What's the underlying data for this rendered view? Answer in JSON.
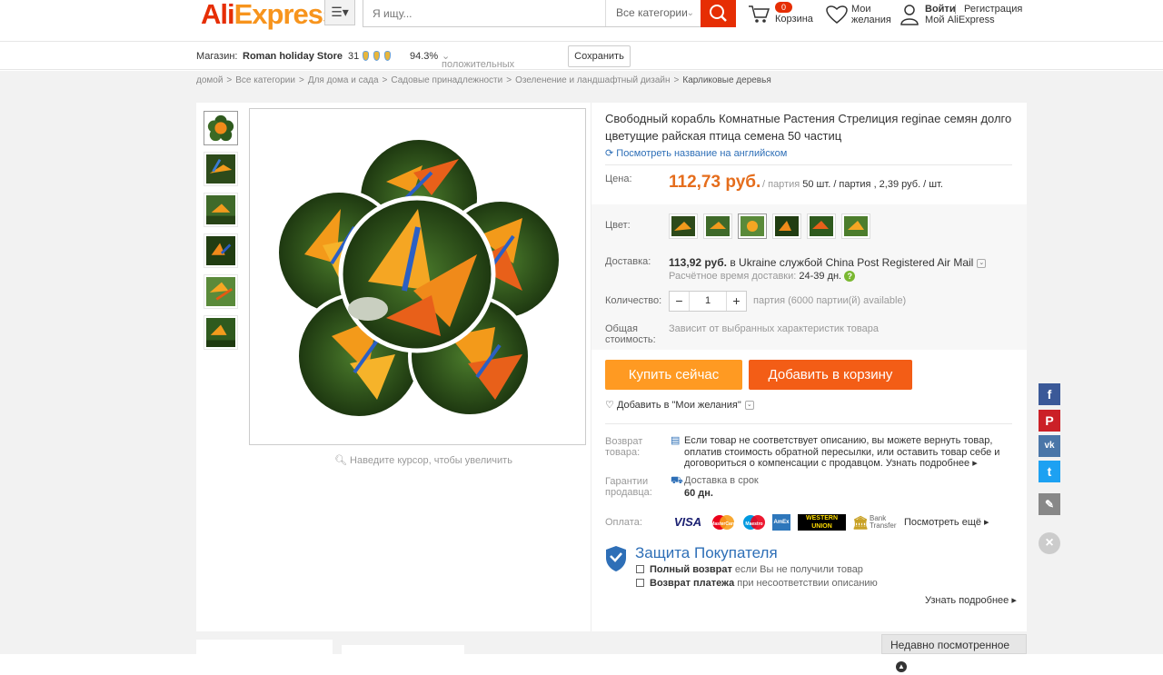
{
  "header": {
    "logo_part1": "Ali",
    "logo_part2": "Express",
    "menu_icon": "hamburger-icon",
    "search_placeholder": "Я ищу...",
    "category_select": "Все категории",
    "cart_label": "Корзина",
    "cart_count": "0",
    "wishlist_line1": "Мои",
    "wishlist_line2": "желания",
    "signin": "Войти",
    "register": "Регистрация",
    "my_account": "Мой AliExpress"
  },
  "store": {
    "label": "Магазин:",
    "name": "Roman holiday Store",
    "score": "31",
    "positive_pct": "94.3%",
    "positive_label": "положительных отзывов",
    "save_button": "Сохранить"
  },
  "breadcrumb": [
    "домой",
    "Все категории",
    "Для дома и сада",
    "Садовые принадлежности",
    "Озеленение и ландшафтный дизайн",
    "Карликовые деревья"
  ],
  "gallery": {
    "zoom_hint": "Наведите курсор, чтобы увеличить"
  },
  "product": {
    "title": "Свободный корабль Комнатные Растения Стрелиция reginae семян долго цветущие райская птица семена 50 частиц",
    "translate_link": "Посмотреть название на английском",
    "price_label": "Цена:",
    "price": "112,73 руб.",
    "price_unit_prefix": "/ партия",
    "price_unit_qty": "50 шт. / партия , 2,39 руб. / шт.",
    "color_label": "Цвет:",
    "delivery_label": "Доставка:",
    "delivery_price": "113,92 руб.",
    "delivery_text": "в Ukraine службой China Post Registered Air Mail",
    "delivery_time_label": "Расчётное время доставки:",
    "delivery_time": "24-39 дн.",
    "qty_label": "Количество:",
    "qty_value": "1",
    "qty_note": "партия (6000 партии(й) available)",
    "total_label_1": "Общая",
    "total_label_2": "стоимость:",
    "total_note": "Зависит от выбранных характеристик товара",
    "buy_now": "Купить сейчас",
    "add_to_cart": "Добавить в корзину",
    "add_wishlist": "Добавить в \"Мои желания\""
  },
  "returns": {
    "label_1": "Возврат",
    "label_2": "товара:",
    "line1": "Если товар не соответствует описанию, вы можете вернуть товар,",
    "line2": "оплатив стоимость обратной пересылки, или оставить товар себе и",
    "line3": "договориться о компенсации с продавцом.",
    "more": "Узнать подробнее"
  },
  "guarantee": {
    "label_1": "Гарантии",
    "label_2": "продавца:",
    "title": "Доставка в срок",
    "value": "60 дн."
  },
  "payment": {
    "label": "Оплата:",
    "methods": [
      "VISA",
      "MasterCard",
      "Maestro",
      "AmEx",
      "WESTERN UNION",
      "Bank Transfer"
    ],
    "more": "Посмотреть ещё"
  },
  "protection": {
    "title": "Защита Покупателя",
    "line1_bold": "Полный возврат",
    "line1_rest": "если Вы не получили товар",
    "line2_bold": "Возврат платежа",
    "line2_rest": "при несоответствии описанию",
    "more": "Узнать подробнее"
  },
  "recent": {
    "label": "Недавно посмотренное"
  },
  "social": [
    "f",
    "P",
    "vk",
    "t",
    "✎",
    "×"
  ],
  "colors": {
    "accent": "#e62e04",
    "buy_now": "#ff9a22",
    "add_cart": "#f35d16",
    "link": "#2e6fb7"
  }
}
